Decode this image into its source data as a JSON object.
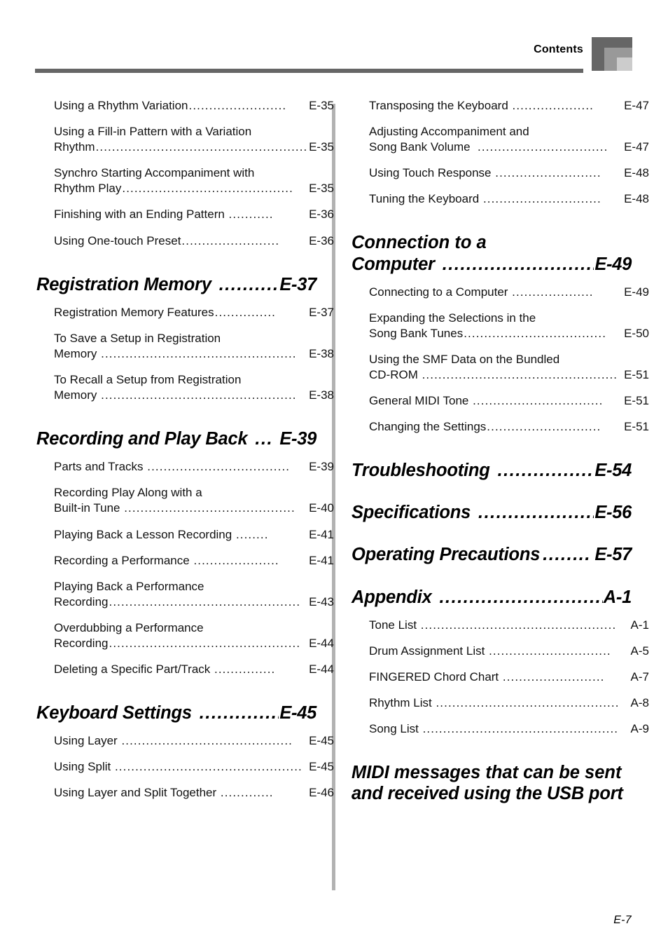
{
  "header": {
    "title": "Contents",
    "corner_mark_colors": {
      "outer": "#666666",
      "middle": "#999999",
      "inner": "#cccccc"
    },
    "rule_color": "#666666"
  },
  "footer": {
    "page_number": "E-7"
  },
  "divider_color": "#b2b2b2",
  "left_column": {
    "entries": [
      {
        "kind": "item",
        "label": "Using a Rhythm Variation",
        "leader": "........................",
        "page": "E-35"
      },
      {
        "kind": "item",
        "label": "Using a Fill-in Pattern with a Variation",
        "label2": "Rhythm",
        "leader": "....................................................",
        "page": "E-35"
      },
      {
        "kind": "item",
        "label": "Synchro Starting Accompaniment with",
        "label2": "Rhythm Play",
        "leader": "..........................................",
        "page": "E-35"
      },
      {
        "kind": "item",
        "label": "Finishing with an Ending Pattern ",
        "leader": "...........",
        "page": "E-36"
      },
      {
        "kind": "item",
        "label": "Using One-touch Preset",
        "leader": "........................",
        "page": "E-36"
      },
      {
        "kind": "section",
        "label": "Registration Memory ",
        "leader": "..........",
        "page": "E-37"
      },
      {
        "kind": "item",
        "label": "Registration Memory Features",
        "leader": "...............",
        "page": "E-37"
      },
      {
        "kind": "item",
        "label": "To Save a Setup in Registration",
        "label2": "Memory ",
        "leader": "................................................",
        "page": "E-38"
      },
      {
        "kind": "item",
        "label": "To Recall a Setup from Registration",
        "label2": "Memory ",
        "leader": "................................................",
        "page": "E-38"
      },
      {
        "kind": "section",
        "label": "Recording and Play Back ",
        "leader": "...",
        "page": "E-39"
      },
      {
        "kind": "item",
        "label": "Parts and Tracks ",
        "leader": "...................................",
        "page": "E-39"
      },
      {
        "kind": "item",
        "label": "Recording Play Along with a",
        "label2": "Built-in Tune ",
        "leader": "..........................................",
        "page": "E-40"
      },
      {
        "kind": "item",
        "label": "Playing Back a Lesson Recording ",
        "leader": "........",
        "page": "E-41"
      },
      {
        "kind": "item",
        "label": "Recording a Performance ",
        "leader": ".....................",
        "page": "E-41"
      },
      {
        "kind": "item",
        "label": "Playing Back a Performance",
        "label2": "Recording",
        "leader": "...............................................",
        "page": "E-43"
      },
      {
        "kind": "item",
        "label": "Overdubbing a Performance",
        "label2": "Recording",
        "leader": "...............................................",
        "page": "E-44"
      },
      {
        "kind": "item",
        "label": "Deleting a Specific Part/Track ",
        "leader": "...............",
        "page": "E-44"
      },
      {
        "kind": "section",
        "label": "Keyboard Settings ",
        "leader": "..............",
        "page": "E-45"
      },
      {
        "kind": "item",
        "label": "Using Layer ",
        "leader": "..........................................",
        "page": "E-45"
      },
      {
        "kind": "item",
        "label": "Using Split ",
        "leader": "..............................................",
        "page": "E-45"
      },
      {
        "kind": "item",
        "label": "Using Layer and Split Together ",
        "leader": ".............",
        "page": "E-46"
      }
    ]
  },
  "right_column": {
    "entries": [
      {
        "kind": "item",
        "label": "Transposing the Keyboard ",
        "leader": "....................",
        "page": "E-47"
      },
      {
        "kind": "item",
        "label": "Adjusting Accompaniment and",
        "label2": "Song Bank Volume  ",
        "leader": "................................",
        "page": "E-47"
      },
      {
        "kind": "item",
        "label": "Using Touch Response ",
        "leader": "..........................",
        "page": "E-48"
      },
      {
        "kind": "item",
        "label": "Tuning the Keyboard ",
        "leader": ".............................",
        "page": "E-48"
      },
      {
        "kind": "section",
        "label": "Connection to a",
        "label2": "Computer ",
        "leader": "............................",
        "page": "E-49"
      },
      {
        "kind": "item",
        "label": "Connecting to a Computer ",
        "leader": "....................",
        "page": "E-49"
      },
      {
        "kind": "item",
        "label": "Expanding the Selections in the",
        "label2": "Song Bank Tunes",
        "leader": "...................................",
        "page": "E-50"
      },
      {
        "kind": "item",
        "label": "Using the SMF Data on the Bundled",
        "label2": "CD-ROM ",
        "leader": "................................................",
        "page": "E-51"
      },
      {
        "kind": "item",
        "label": "General MIDI Tone ",
        "leader": "................................",
        "page": "E-51"
      },
      {
        "kind": "item",
        "label": "Changing the Settings",
        "leader": "............................",
        "page": "E-51"
      },
      {
        "kind": "section",
        "label": "Troubleshooting ",
        "leader": ".................",
        "page": "E-54"
      },
      {
        "kind": "section",
        "label": "Specifications ",
        "leader": "......................",
        "page": "E-56"
      },
      {
        "kind": "section",
        "label": "Operating Precautions",
        "leader": "........",
        "page": "E-57"
      },
      {
        "kind": "section",
        "label": "Appendix ",
        "leader": "................................",
        "page": "A-1"
      },
      {
        "kind": "item",
        "label": "Tone List ",
        "leader": "................................................",
        "page": "A-1"
      },
      {
        "kind": "item",
        "label": "Drum Assignment List ",
        "leader": "..............................",
        "page": "A-5"
      },
      {
        "kind": "item",
        "label": "FINGERED Chord Chart ",
        "leader": ".........................",
        "page": "A-7"
      },
      {
        "kind": "item",
        "label": "Rhythm List ",
        "leader": ".............................................",
        "page": "A-8"
      },
      {
        "kind": "item",
        "label": "Song List ",
        "leader": "................................................",
        "page": "A-9"
      },
      {
        "kind": "section_nopage",
        "label": "MIDI messages that can be sent",
        "label2": "and received using the USB port"
      }
    ]
  }
}
